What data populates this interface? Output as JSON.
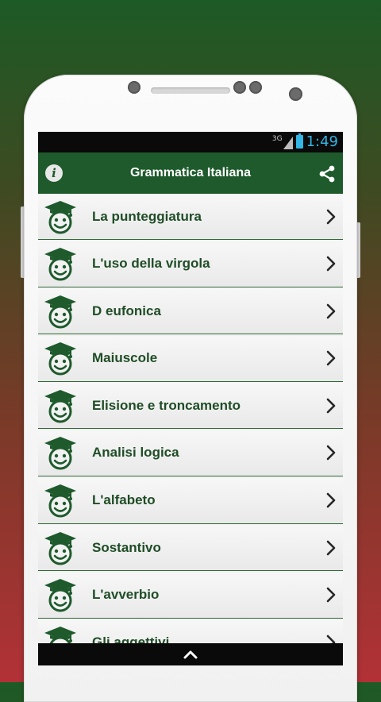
{
  "status_bar": {
    "network": "3G",
    "time": "1:49"
  },
  "app_bar": {
    "title": "Grammatica Italiana"
  },
  "list": {
    "items": [
      {
        "label": "La punteggiatura"
      },
      {
        "label": "L'uso della virgola"
      },
      {
        "label": "D eufonica"
      },
      {
        "label": "Maiuscole"
      },
      {
        "label": "Elisione e troncamento"
      },
      {
        "label": "Analisi logica"
      },
      {
        "label": "L'alfabeto"
      },
      {
        "label": "Sostantivo"
      },
      {
        "label": "L'avverbio"
      },
      {
        "label": "Gli aggettivi"
      }
    ]
  },
  "icons": {
    "info": "info-icon",
    "share": "share-icon",
    "avatar": "graduate-face-icon",
    "chevron": "chevron-right-icon",
    "nav_up": "chevron-up-icon"
  },
  "colors": {
    "app_bar": "#1e5a2c",
    "row_text": "#1f4d26",
    "clock": "#33b5e5",
    "bg_top": "#1d5a25",
    "bg_bottom": "#b23137"
  }
}
